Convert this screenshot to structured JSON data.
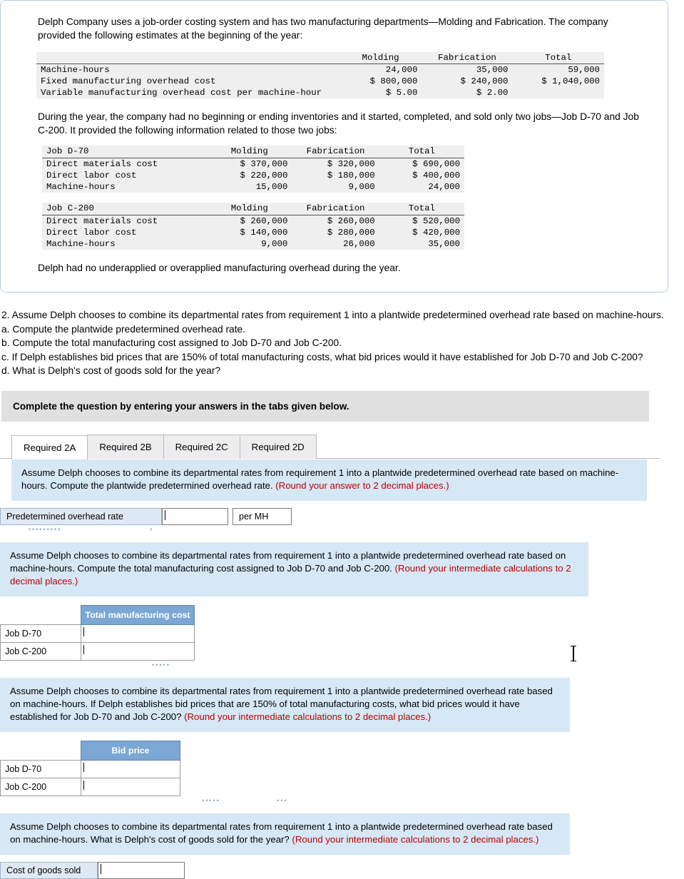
{
  "problem": {
    "intro": "Delph Company uses a job-order costing system and has two manufacturing departments—Molding and Fabrication. The company provided the following estimates at the beginning of the year:",
    "estimates": {
      "headers": [
        "",
        "Molding",
        "Fabrication",
        "Total"
      ],
      "rows": [
        {
          "label": "Machine-hours",
          "molding": "24,000",
          "fabrication": "35,000",
          "total": "59,000"
        },
        {
          "label": "Fixed manufacturing overhead cost",
          "molding": "$ 800,000",
          "fabrication": "$ 240,000",
          "total": "$ 1,040,000"
        },
        {
          "label": "Variable manufacturing overhead cost per machine-hour",
          "molding": "$ 5.00",
          "fabrication": "$ 2.00",
          "total": ""
        }
      ]
    },
    "mid": "During the year, the company had no beginning or ending inventories and it started, completed, and sold only two jobs—Job D-70 and Job C-200. It provided the following information related to those two jobs:",
    "job_d70": {
      "headers": [
        "Job D-70",
        "Molding",
        "Fabrication",
        "Total"
      ],
      "rows": [
        {
          "label": "Direct materials cost",
          "molding": "$ 370,000",
          "fabrication": "$ 320,000",
          "total": "$ 690,000"
        },
        {
          "label": "Direct labor cost",
          "molding": "$ 220,000",
          "fabrication": "$ 180,000",
          "total": "$ 400,000"
        },
        {
          "label": "Machine-hours",
          "molding": "15,000",
          "fabrication": "9,000",
          "total": "24,000"
        }
      ]
    },
    "job_c200": {
      "headers": [
        "Job C-200",
        "Molding",
        "Fabrication",
        "Total"
      ],
      "rows": [
        {
          "label": "Direct materials cost",
          "molding": "$ 260,000",
          "fabrication": "$ 260,000",
          "total": "$ 520,000"
        },
        {
          "label": "Direct labor cost",
          "molding": "$ 140,000",
          "fabrication": "$ 280,000",
          "total": "$ 420,000"
        },
        {
          "label": "Machine-hours",
          "molding": "9,000",
          "fabrication": "26,000",
          "total": "35,000"
        }
      ]
    },
    "closing": "Delph had no underapplied or overapplied manufacturing overhead during the year."
  },
  "requirement": {
    "line1": "2. Assume Delph chooses to combine its departmental rates from requirement 1 into a plantwide predetermined overhead rate based on machine-hours.",
    "line_a": "a. Compute the plantwide predetermined overhead rate.",
    "line_b": "b. Compute the total manufacturing cost assigned to Job D-70 and Job C-200.",
    "line_c": "c. If Delph establishes bid prices that are 150% of total manufacturing costs, what bid prices would it have established for Job D-70 and Job C-200?",
    "line_d": "d. What is Delph's cost of goods sold for the year?"
  },
  "complete_bar": "Complete the question by entering your answers in the tabs given below.",
  "tabs": [
    {
      "label": "Required 2A",
      "active": true
    },
    {
      "label": "Required 2B",
      "active": false
    },
    {
      "label": "Required 2C",
      "active": false
    },
    {
      "label": "Required 2D",
      "active": false
    }
  ],
  "sections": {
    "a": {
      "text_plain": "Assume Delph chooses to combine its departmental rates from requirement 1 into a plantwide predetermined overhead rate based on machine-hours. Compute the plantwide predetermined overhead rate. ",
      "text_red": "(Round your answer to 2 decimal places.)",
      "row_label": "Predetermined overhead rate",
      "input_value": "",
      "unit": "per MH"
    },
    "b": {
      "text_plain": "Assume Delph chooses to combine its departmental rates from requirement 1 into a plantwide predetermined overhead rate based on machine-hours. Compute the total manufacturing cost assigned to Job D-70 and Job C-200. ",
      "text_red": "(Round your intermediate calculations to 2 decimal places.)",
      "column_header": "Total manufacturing cost",
      "rows": [
        {
          "label": "Job D-70",
          "value": ""
        },
        {
          "label": "Job C-200",
          "value": ""
        }
      ]
    },
    "c": {
      "text_plain": "Assume Delph chooses to combine its departmental rates from requirement 1 into a plantwide predetermined overhead rate based on machine-hours. If Delph establishes bid prices that are 150% of total manufacturing costs, what bid prices would it have established for Job D-70 and Job C-200? ",
      "text_red": "(Round your intermediate calculations to 2 decimal places.)",
      "column_header": "Bid price",
      "rows": [
        {
          "label": "Job D-70",
          "value": ""
        },
        {
          "label": "Job C-200",
          "value": ""
        }
      ]
    },
    "d": {
      "text_plain": "Assume Delph chooses to combine its departmental rates from requirement 1 into a plantwide predetermined overhead rate based on machine-hours. What is Delph's cost of goods sold for the year? ",
      "text_red": "(Round your intermediate calculations to 2 decimal places.)",
      "row_label": "Cost of goods sold",
      "input_value": ""
    }
  }
}
